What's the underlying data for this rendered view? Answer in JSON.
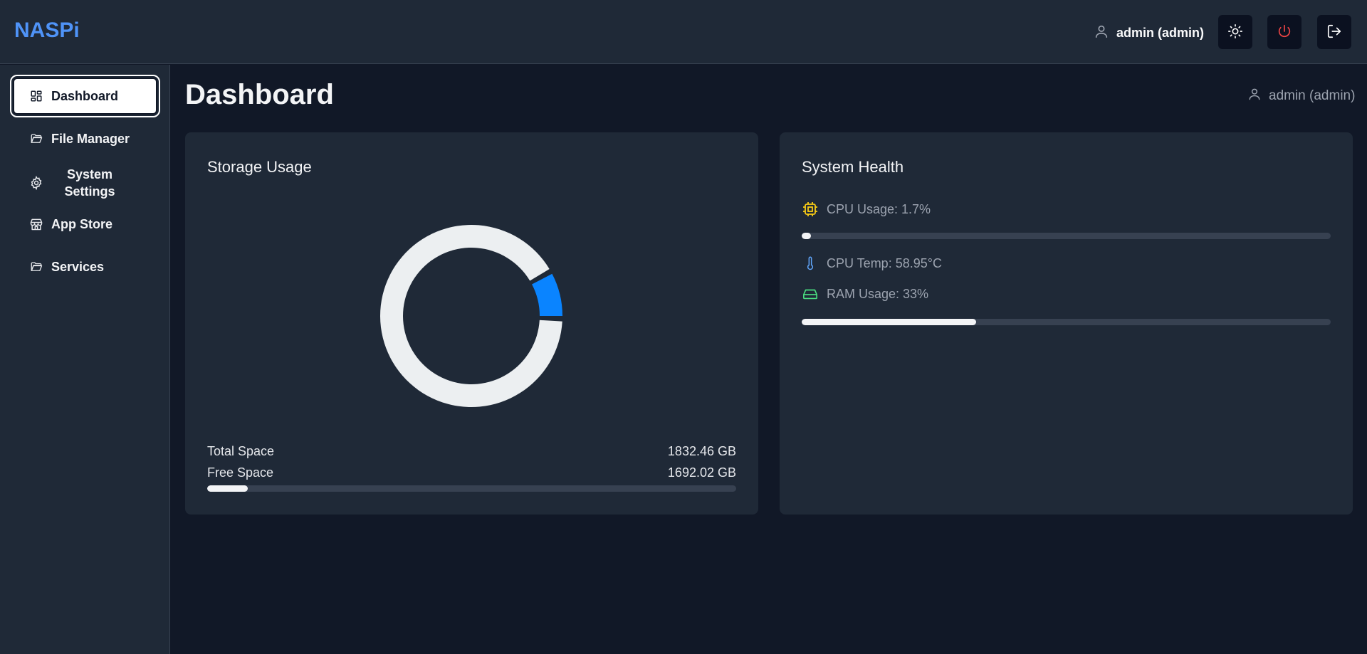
{
  "app": {
    "brand": "NASPi"
  },
  "header": {
    "user_label": "admin (admin)",
    "icons": [
      "user-icon",
      "sun-icon",
      "power-icon",
      "logout-icon"
    ],
    "power_color": "#ef4444"
  },
  "sidebar": {
    "items": [
      {
        "label": "Dashboard",
        "icon": "dashboard-icon",
        "active": true
      },
      {
        "label": "File Manager",
        "icon": "folder-icon",
        "active": false
      },
      {
        "label": "System Settings",
        "icon": "gear-icon",
        "active": false
      },
      {
        "label": "App Store",
        "icon": "store-icon",
        "active": false
      },
      {
        "label": "Services",
        "icon": "folder-icon",
        "active": false
      }
    ]
  },
  "page": {
    "title": "Dashboard",
    "user_label": "admin (admin)"
  },
  "storage": {
    "title": "Storage Usage",
    "total_label": "Total Space",
    "total_value": "1832.46 GB",
    "free_label": "Free Space",
    "free_value": "1692.02 GB",
    "total_gb": 1832.46,
    "free_gb": 1692.02,
    "used_color": "#0a84ff",
    "free_color": "#eceff1"
  },
  "health": {
    "title": "System Health",
    "cpu_usage_label": "CPU Usage: 1.7%",
    "cpu_usage_pct": 1.7,
    "cpu_temp_label": "CPU Temp: 58.95°C",
    "ram_usage_label": "RAM Usage: 33%",
    "ram_usage_pct": 33,
    "cpu_icon_color": "#facc15",
    "temp_icon_color": "#60a5fa",
    "ram_icon_color": "#4ade80"
  }
}
